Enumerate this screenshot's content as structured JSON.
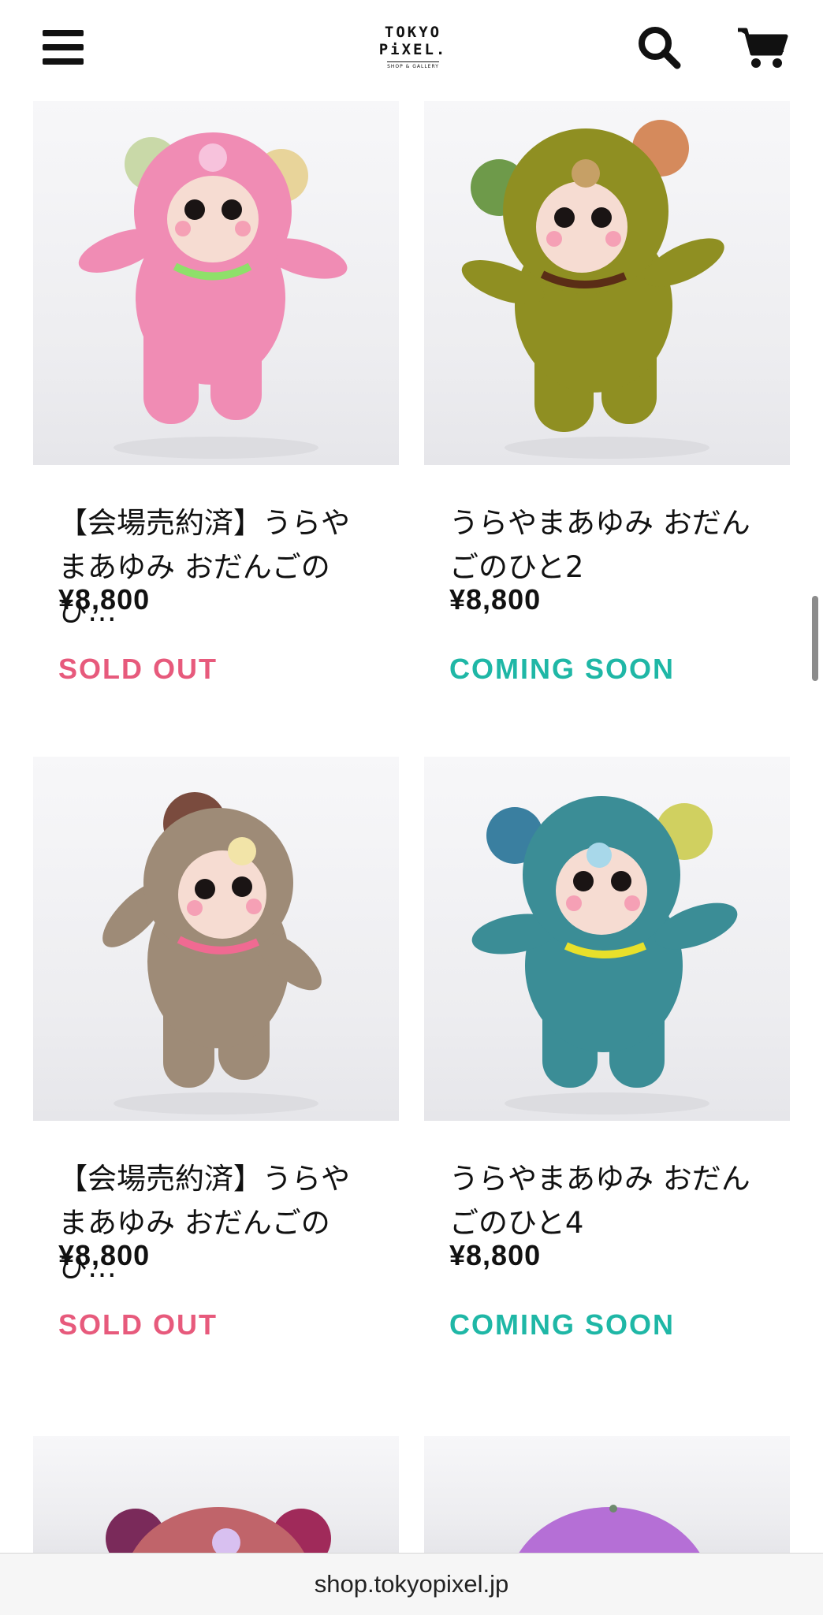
{
  "header": {
    "logo_line1": "TOKYO",
    "logo_line2": "PiXEL.",
    "logo_line3": "SHOP & GALLERY",
    "menu_icon": "hamburger-icon",
    "search_icon": "search-icon",
    "cart_icon": "cart-icon"
  },
  "products": [
    {
      "name": "【会場売約済】うらやまあゆみ おだんごのひ…",
      "price": "¥8,800",
      "status": "SOLD OUT",
      "status_color": "#e75a7c",
      "plush_color": "#f08cb4",
      "bow_color": "#8ee06a"
    },
    {
      "name": "うらやまあゆみ おだんごのひと2",
      "price": "¥8,800",
      "status": "COMING SOON",
      "status_color": "#1fb7a6",
      "plush_color": "#8f8f22",
      "bow_color": "#5a2d16"
    },
    {
      "name": "【会場売約済】うらやまあゆみ おだんごのひ…",
      "price": "¥8,800",
      "status": "SOLD OUT",
      "status_color": "#e75a7c",
      "plush_color": "#9e8b77",
      "bow_color": "#f06a92"
    },
    {
      "name": "うらやまあゆみ おだんごのひと4",
      "price": "¥8,800",
      "status": "COMING SOON",
      "status_color": "#1fb7a6",
      "plush_color": "#3b8d96",
      "bow_color": "#e8e02a"
    },
    {
      "plush_color": "#c0646a"
    },
    {
      "plush_color": "#b56fd6"
    }
  ],
  "url_bar": {
    "url": "shop.tokyopixel.jp"
  }
}
